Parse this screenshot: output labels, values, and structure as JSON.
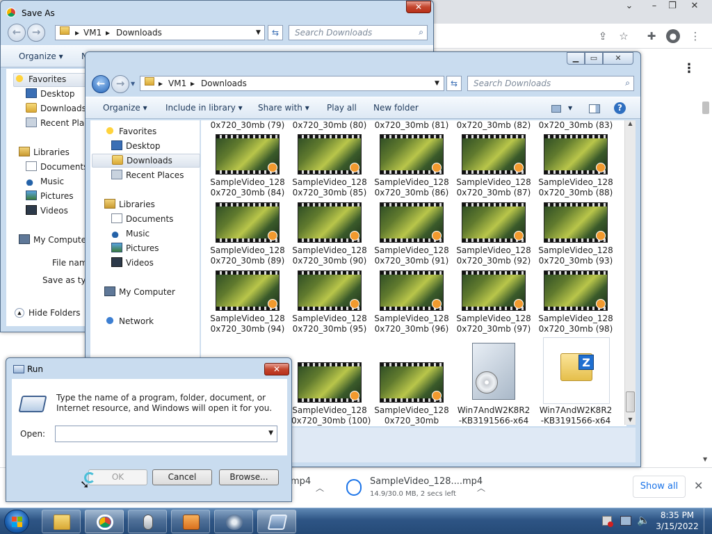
{
  "chrome": {
    "controls": [
      "–",
      "❐",
      "✕"
    ],
    "toolbar_icons": [
      "share-icon",
      "star-icon",
      "extensions-icon",
      "profile-icon",
      "menu-icon"
    ],
    "page_menu_icon": "⋮",
    "downloads": [
      {
        "name": "mp4",
        "status": ""
      },
      {
        "name": "SampleVideo_128....mp4",
        "status": "14.9/30.0 MB, 2 secs left"
      }
    ],
    "show_all": "Show all",
    "close": "✕"
  },
  "save_as": {
    "title": "Save As",
    "address": [
      "VM1",
      "Downloads"
    ],
    "search_placeholder": "Search Downloads",
    "organize": "Organize ▾",
    "new_folder_partial": "N",
    "nav": {
      "favorites": "Favorites",
      "desktop": "Desktop",
      "downloads": "Downloads",
      "recent": "Recent Place",
      "libraries": "Libraries",
      "documents": "Documents",
      "music": "Music",
      "pictures": "Pictures",
      "videos": "Videos",
      "computer": "My Computer"
    },
    "file_name_label": "File name",
    "save_type_label": "Save as type",
    "hide_folders": "Hide Folders"
  },
  "explorer": {
    "address": [
      "VM1",
      "Downloads"
    ],
    "search_placeholder": "Search Downloads",
    "commands": {
      "organize": "Organize ▾",
      "include": "Include in library ▾",
      "share": "Share with ▾",
      "play": "Play all",
      "newfolder": "New folder"
    },
    "nav": {
      "favorites": "Favorites",
      "desktop": "Desktop",
      "downloads": "Downloads",
      "recent": "Recent Places",
      "libraries": "Libraries",
      "documents": "Documents",
      "music": "Music",
      "pictures": "Pictures",
      "videos": "Videos",
      "computer": "My Computer",
      "network": "Network"
    },
    "top_row_labels": [
      "0x720_30mb (79)",
      "0x720_30mb (80)",
      "0x720_30mb (81)",
      "0x720_30mb (82)",
      "0x720_30mb (83)"
    ],
    "files": [
      {
        "l1": "SampleVideo_128",
        "l2": "0x720_30mb (84)"
      },
      {
        "l1": "SampleVideo_128",
        "l2": "0x720_30mb (85)"
      },
      {
        "l1": "SampleVideo_128",
        "l2": "0x720_30mb (86)"
      },
      {
        "l1": "SampleVideo_128",
        "l2": "0x720_30mb (87)"
      },
      {
        "l1": "SampleVideo_128",
        "l2": "0x720_30mb (88)"
      },
      {
        "l1": "SampleVideo_128",
        "l2": "0x720_30mb (89)"
      },
      {
        "l1": "SampleVideo_128",
        "l2": "0x720_30mb (90)"
      },
      {
        "l1": "SampleVideo_128",
        "l2": "0x720_30mb (91)"
      },
      {
        "l1": "SampleVideo_128",
        "l2": "0x720_30mb (92)"
      },
      {
        "l1": "SampleVideo_128",
        "l2": "0x720_30mb (93)"
      },
      {
        "l1": "SampleVideo_128",
        "l2": "0x720_30mb (94)"
      },
      {
        "l1": "SampleVideo_128",
        "l2": "0x720_30mb (95)"
      },
      {
        "l1": "SampleVideo_128",
        "l2": "0x720_30mb (96)"
      },
      {
        "l1": "SampleVideo_128",
        "l2": "0x720_30mb (97)"
      },
      {
        "l1": "SampleVideo_128",
        "l2": "0x720_30mb (98)"
      },
      {
        "l1": "SampleVideo_128",
        "l2": "0x720_30mb (100)"
      },
      {
        "l1": "SampleVideo_128",
        "l2": "0x720_30mb"
      },
      {
        "l1": "Win7AndW2K8R2",
        "l2": "-KB3191566-x64"
      },
      {
        "l1": "Win7AndW2K8R2",
        "l2": "-KB3191566-x64"
      }
    ]
  },
  "run": {
    "title": "Run",
    "description": "Type the name of a program, folder, document, or Internet resource, and Windows will open it for you.",
    "open_label": "Open:",
    "open_value": "",
    "ok": "OK",
    "cancel": "Cancel",
    "browse": "Browse..."
  },
  "taskbar": {
    "time": "8:35 PM",
    "date": "3/15/2022"
  }
}
